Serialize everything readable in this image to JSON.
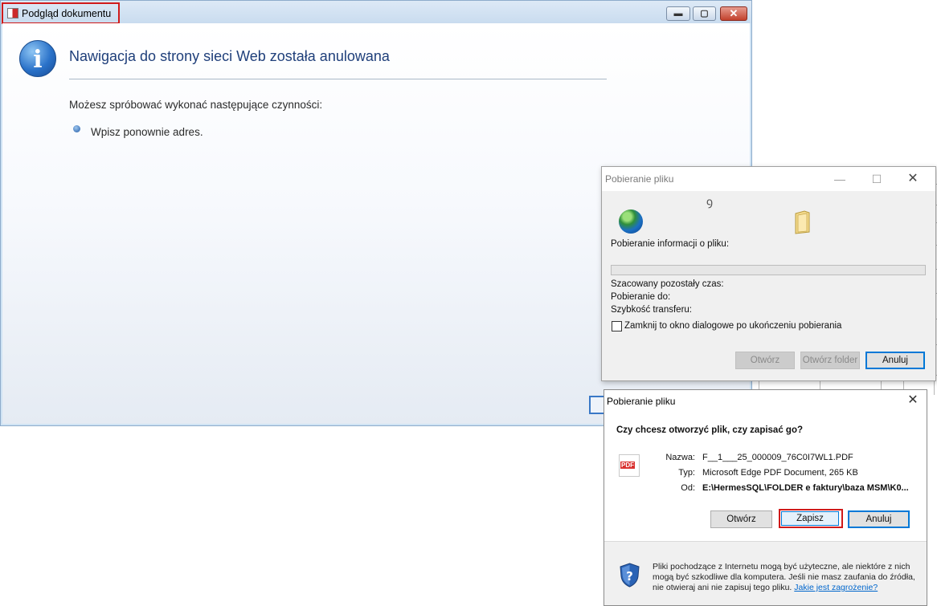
{
  "main_window": {
    "title": "Podgląd dokumentu",
    "heading": "Nawigacja do strony sieci Web została anulowana",
    "subheading": "Możesz spróbować wykonać następujące czynności:",
    "bullets": [
      "Wpisz ponownie adres."
    ],
    "caption_buttons": {
      "minimize": "▬",
      "maximize": "▢",
      "close": "✕"
    }
  },
  "download_dialog": {
    "title": "Pobieranie pliku",
    "status": "Pobieranie informacji o pliku:",
    "progress": 0,
    "labels": {
      "time_left": "Szacowany pozostały czas:",
      "download_to": "Pobieranie do:",
      "transfer_rate": "Szybkość transferu:"
    },
    "close_when_done_label": "Zamknij to okno dialogowe po ukończeniu pobierania",
    "close_when_done_checked": false,
    "buttons": {
      "open": "Otwórz",
      "open_folder": "Otwórz folder",
      "cancel": "Anuluj"
    },
    "caption_buttons": {
      "minimize": "—",
      "maximize": "☐",
      "close": "✕"
    }
  },
  "save_dialog": {
    "title": "Pobieranie pliku",
    "question": "Czy chcesz otworzyć plik, czy zapisać go?",
    "file_icon_text": "PDF",
    "fields": {
      "name_label": "Nazwa:",
      "name_value": "F__1___25_000009_76C0I7WL1.PDF",
      "type_label": "Typ:",
      "type_value": "Microsoft Edge PDF Document, 265 KB",
      "from_label": "Od:",
      "from_value": "E:\\HermesSQL\\FOLDER e faktury\\baza MSM\\K0..."
    },
    "buttons": {
      "open": "Otwórz",
      "save": "Zapisz",
      "cancel": "Anuluj"
    },
    "close_glyph": "✕",
    "warning_text": "Pliki pochodzące z Internetu mogą być użyteczne, ale niektóre z nich mogą być szkodliwe dla komputera. Jeśli nie masz zaufania do źródła, nie otwieraj ani nie zapisuj tego pliku.",
    "warning_link": "Jakie jest zagrożenie?"
  },
  "colors": {
    "highlight_red": "#d01a1a",
    "heading_blue": "#1f3f7a",
    "accent_blue": "#0078d7",
    "progress_green": "#06b025"
  }
}
